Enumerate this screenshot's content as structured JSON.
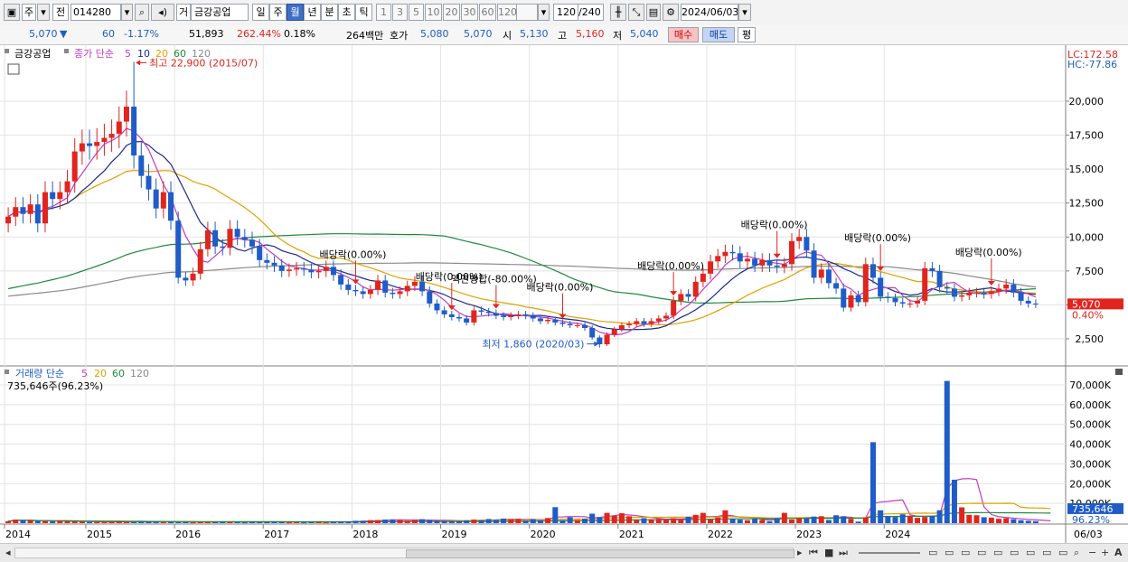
{
  "toolbar": {
    "market_label": "주",
    "prev_label": "전",
    "code": "014280",
    "trade_label": "거",
    "company": "금강공업",
    "periods": [
      "일",
      "주",
      "월",
      "년",
      "분",
      "초",
      "틱"
    ],
    "selected_period": "월",
    "minutes": [
      "1",
      "3",
      "5",
      "10",
      "20",
      "30",
      "60",
      "120"
    ],
    "count": "120",
    "count_total": "/240",
    "date": "2024/06/03"
  },
  "quote": {
    "price": "5,070",
    "change": "60",
    "change_pct": "-1.17%",
    "volume": "51,893",
    "vol_ratio": "262.44%",
    "turnover": "0.18%",
    "amount": "264백만",
    "bid_label": "호가",
    "bid": "5,080",
    "ask": "5,070",
    "open_label": "시",
    "open": "5,130",
    "high_label": "고",
    "high": "5,160",
    "low_label": "저",
    "low": "5,040",
    "buy_label": "매수",
    "sell_label": "매도",
    "eval_label": "평"
  },
  "colors": {
    "up": "#e0251e",
    "down": "#1f5cc8",
    "ma5": "#c23bc2",
    "ma10": "#1b2a8c",
    "ma20": "#e0a000",
    "ma60": "#1f8a3a",
    "ma120": "#8a8a8a"
  },
  "chart_data": [
    {
      "type": "candlestick",
      "legend": {
        "title": "금강공업",
        "indicator": "종가 단순",
        "periods": [
          "5",
          "10",
          "20",
          "60",
          "120"
        ]
      },
      "lc": "LC:172.58",
      "hc": "HC:-77.86",
      "current_price": "5,070",
      "current_pct": "0.40%",
      "yticks": [
        2500,
        5000,
        7500,
        10000,
        12500,
        15000,
        17500,
        20000
      ],
      "ytick_labels": [
        "2,500",
        "5,000",
        "7,500",
        "10,000",
        "12,500",
        "15,000",
        "17,500",
        "20,000"
      ],
      "ylim": [
        0,
        22900
      ],
      "x_labels": [
        "2014",
        "2015",
        "2016",
        "2017",
        "2018",
        "2019",
        "2020",
        "2021",
        "2022",
        "2023",
        "2024",
        "06/03"
      ],
      "annotations": {
        "high": "최고 22,900 (2015/07)",
        "low": "최저 1,860 (2020/03)",
        "events": [
          "배당락(0.00%)",
          "배당락(0.00%)",
          "액면병합(-80.00%)",
          "배당락(0.00%)",
          "배당락(0.00%)",
          "배당락(0.00%)",
          "배당락(0.00%)",
          "배당락(0.00%)"
        ]
      },
      "close": [
        11500,
        12200,
        11700,
        12400,
        11000,
        13300,
        12800,
        13300,
        14100,
        16300,
        16900,
        16700,
        17000,
        17300,
        17600,
        18500,
        19600,
        16000,
        14500,
        13500,
        12100,
        13300,
        11200,
        7000,
        6800,
        7300,
        9100,
        10500,
        9300,
        9200,
        10600,
        10000,
        9800,
        9300,
        8300,
        8100,
        7900,
        7500,
        7600,
        7700,
        7600,
        7400,
        7500,
        7800,
        7200,
        6500,
        6100,
        6000,
        5800,
        6100,
        6800,
        5900,
        5800,
        6000,
        6400,
        6700,
        6000,
        5100,
        4600,
        4300,
        4100,
        4000,
        3700,
        4600,
        4500,
        4400,
        4200,
        4100,
        4200,
        4300,
        4200,
        4000,
        3800,
        3900,
        3700,
        3600,
        3500,
        3500,
        3300,
        2600,
        2100,
        2800,
        3200,
        3500,
        3600,
        3800,
        3600,
        3800,
        4000,
        4200,
        5300,
        5800,
        5600,
        6700,
        7300,
        8200,
        8600,
        8900,
        8800,
        8200,
        8400,
        7900,
        8300,
        7900,
        7800,
        8000,
        9700,
        10000,
        9000,
        7000,
        7600,
        6600,
        6200,
        4800,
        5700,
        5200,
        8000,
        7000,
        5600,
        5500,
        5200,
        5100,
        5100,
        5300,
        7700,
        7500,
        6300,
        6200,
        5600,
        5700,
        5900,
        5900,
        5800,
        6000,
        6200,
        6500,
        5900,
        5300,
        5100,
        5070
      ],
      "volume_panel": {
        "legend": "거래량 단순",
        "periods": [
          "5",
          "20",
          "60",
          "120"
        ],
        "last_text": "735,646주(96.23%)",
        "current_volume": "735,646",
        "current_pct": "96.23%",
        "yticks": [
          10000,
          20000,
          30000,
          40000,
          50000,
          60000,
          70000
        ],
        "ytick_labels": [
          "10,000K",
          "20,000K",
          "30,000K",
          "40,000K",
          "50,000K",
          "60,000K",
          "70,000K"
        ],
        "ylim": [
          0,
          76000
        ],
        "volume": [
          1000,
          1800,
          1500,
          1300,
          1100,
          1000,
          900,
          1200,
          900,
          800,
          700,
          600,
          600,
          600,
          600,
          700,
          600,
          500,
          600,
          700,
          600,
          500,
          600,
          500,
          600,
          400,
          500,
          500,
          500,
          600,
          500,
          500,
          400,
          600,
          500,
          500,
          700,
          500,
          400,
          500,
          400,
          500,
          500,
          400,
          600,
          800,
          900,
          1200,
          1200,
          1500,
          1500,
          1800,
          1900,
          1500,
          1200,
          1500,
          2000,
          1500,
          1300,
          1200,
          1100,
          1200,
          1400,
          1800,
          1500,
          2100,
          1700,
          2300,
          2000,
          2000,
          1300,
          2000,
          1500,
          2600,
          8100,
          1500,
          3000,
          1600,
          2200,
          4800,
          3000,
          5200,
          3800,
          5000,
          3500,
          1500,
          2500,
          2000,
          2200,
          1800,
          2500,
          2100,
          3200,
          4200,
          5200,
          1800,
          2800,
          6500,
          2200,
          1800,
          1500,
          2200,
          1600,
          1000,
          2500,
          5200,
          1800,
          2400,
          2300,
          3300,
          3500,
          1600,
          4000,
          3500,
          2200,
          800,
          2900,
          41000,
          6500,
          3600,
          3100,
          4500,
          3500,
          2700,
          3100,
          3600,
          6500,
          72000,
          22000,
          8000,
          4200,
          4000,
          3000,
          2800,
          2200,
          2500,
          2000,
          1500,
          1200,
          1000,
          1500,
          735
        ]
      }
    }
  ]
}
